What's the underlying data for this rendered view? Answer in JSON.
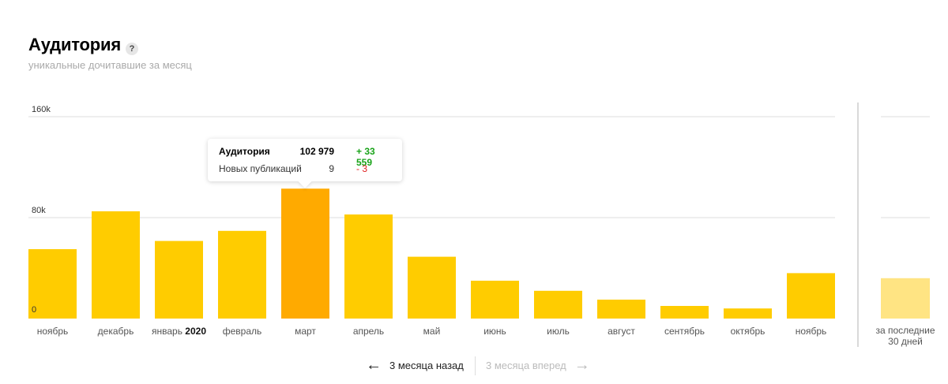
{
  "header": {
    "title": "Аудитория",
    "help_icon": "?",
    "subtitle": "уникальные дочитавшие за месяц"
  },
  "chart_data": {
    "type": "bar",
    "categories": [
      "ноябрь",
      "декабрь",
      "январь",
      "февраль",
      "март",
      "апрель",
      "май",
      "июнь",
      "июль",
      "август",
      "сентябрь",
      "октябрь",
      "ноябрь"
    ],
    "category_suffixes": [
      "",
      "",
      "2020",
      "",
      "",
      "",
      "",
      "",
      "",
      "",
      "",
      "",
      ""
    ],
    "values": [
      55000,
      85000,
      61500,
      69500,
      102979,
      82500,
      49000,
      30000,
      22000,
      15000,
      10000,
      8000,
      36000
    ],
    "highlight_index": 4,
    "ylim": [
      0,
      160000
    ],
    "yticks": [
      {
        "value": 0,
        "label": "0"
      },
      {
        "value": 80000,
        "label": "80k"
      },
      {
        "value": 160000,
        "label": "160k"
      }
    ],
    "colors": {
      "bar": "#ffcc00",
      "highlight": "#ffaa00",
      "last30": "#ffe483",
      "grid": "#dddddd",
      "divider": "#d9d9d9"
    },
    "last30": {
      "label_line1": "за последние",
      "label_line2": "30 дней",
      "value": 32000
    },
    "grid": true
  },
  "tooltip": {
    "row1": {
      "label": "Аудитория",
      "value": "102 979",
      "delta": "+ 33 559"
    },
    "row2": {
      "label": "Новых публикаций",
      "value": "9",
      "delta": "- 3"
    }
  },
  "nav": {
    "back_label": "3 месяца назад",
    "forward_label": "3 месяца вперед",
    "back_icon": "←",
    "forward_icon": "→"
  }
}
